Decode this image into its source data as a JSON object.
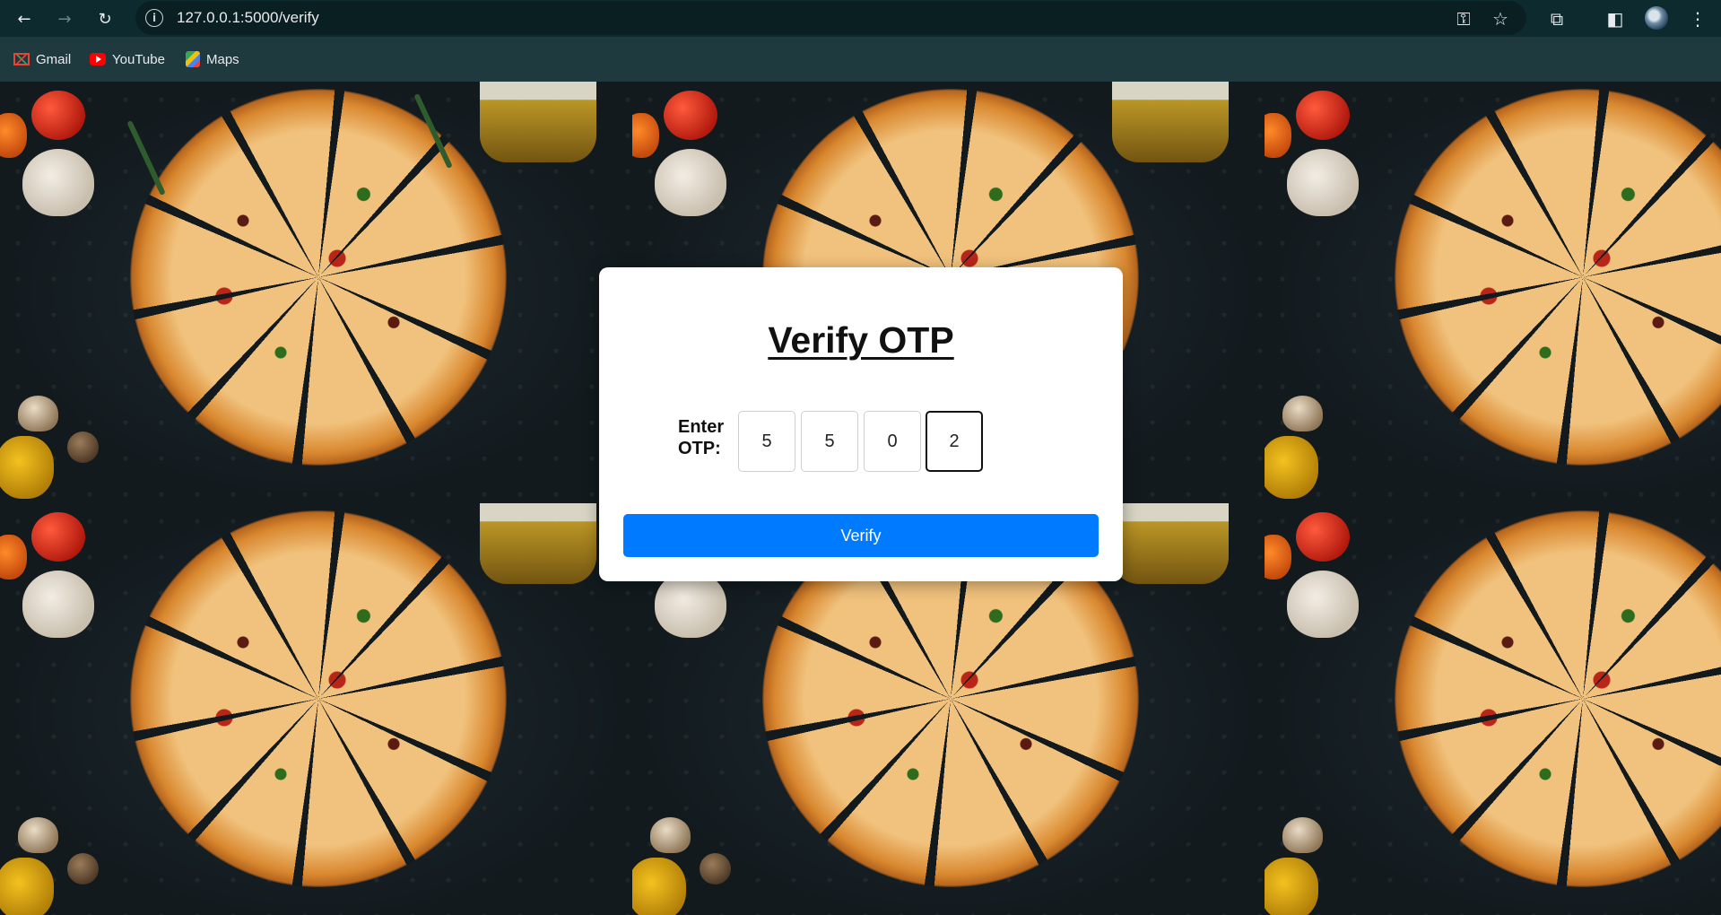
{
  "browser": {
    "url": "127.0.0.1:5000/verify",
    "bookmarks": [
      {
        "label": "Gmail",
        "icon": "gmail-icon"
      },
      {
        "label": "YouTube",
        "icon": "youtube-icon"
      },
      {
        "label": "Maps",
        "icon": "maps-icon"
      }
    ]
  },
  "form": {
    "title": "Verify OTP",
    "otp_label": "Enter OTP:",
    "otp_digits": [
      "5",
      "5",
      "0",
      "2"
    ],
    "submit_label": "Verify"
  },
  "colors": {
    "button_bg": "#007bff",
    "chrome_bg": "#0d2b2f",
    "bookmark_bar_bg": "#1e3a3e"
  }
}
